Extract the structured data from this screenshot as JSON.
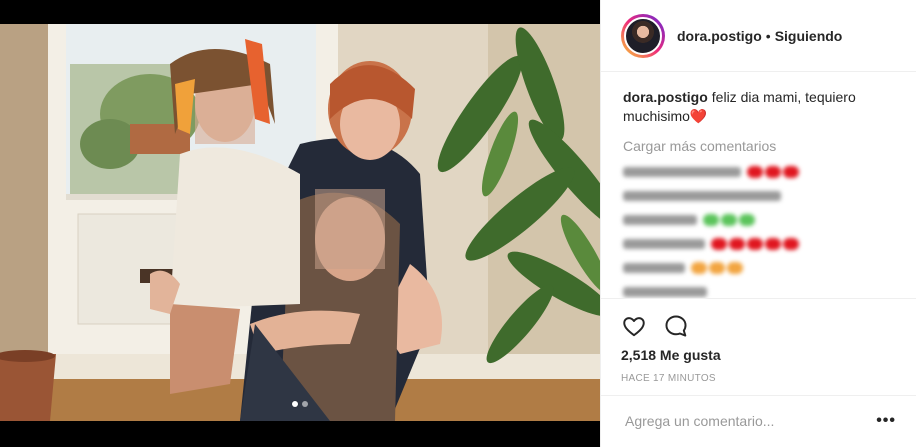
{
  "post": {
    "username": "dora.postigo",
    "separator": "•",
    "follow_status": "Siguiendo",
    "caption_user": "dora.postigo",
    "caption_text": "feliz dia mami, tequiero muchisimo",
    "caption_emoji": "❤️",
    "load_more": "Cargar más comentarios",
    "likes": "2,518 Me gusta",
    "time_ago": "HACE 17 MINUTOS",
    "comment_placeholder": "Agrega un comentario...",
    "more_options": "•••"
  },
  "icons": {
    "like": "heart-outline-icon",
    "comment": "speech-bubble-icon",
    "options": "ellipsis-icon"
  },
  "carousel": {
    "count": 2,
    "active": 1
  },
  "colors": {
    "text": "#262626",
    "muted": "#999999",
    "border": "#efefef",
    "heart_red": "#e0161f",
    "heart_green": "#5cc45c",
    "heart_orange": "#f2a541"
  }
}
